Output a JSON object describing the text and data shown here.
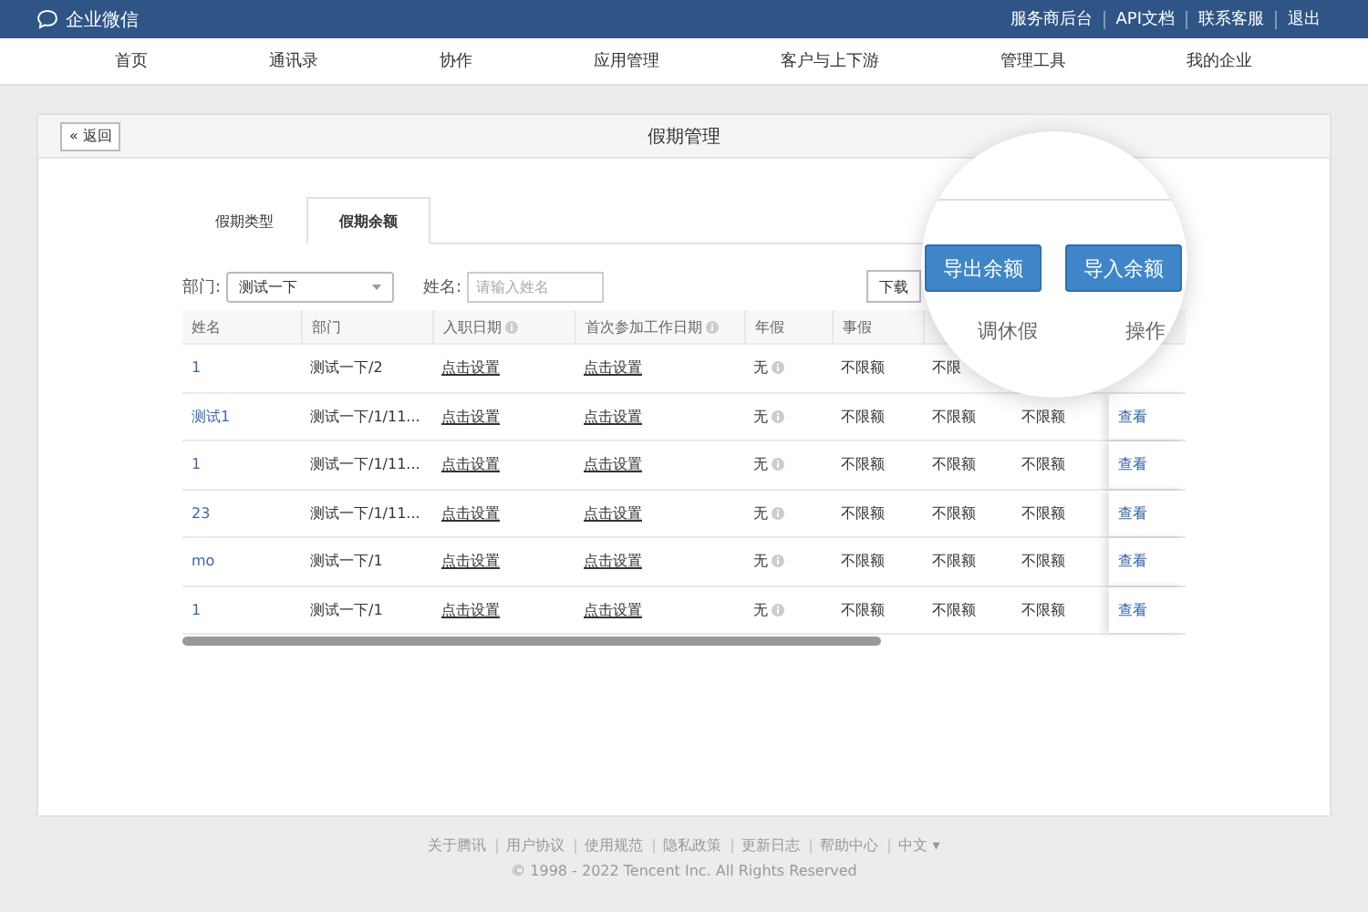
{
  "topbar": {
    "logo": "企业微信",
    "links": [
      "服务商后台",
      "API文档",
      "联系客服",
      "退出"
    ]
  },
  "nav": [
    "首页",
    "通讯录",
    "协作",
    "应用管理",
    "客户与上下游",
    "管理工具",
    "我的企业"
  ],
  "card": {
    "back": "« 返回",
    "title": "假期管理"
  },
  "tabs": [
    {
      "label": "假期类型",
      "selected": false
    },
    {
      "label": "假期余额",
      "selected": true
    }
  ],
  "filters": {
    "department_label": "部门:",
    "department": "测试一下",
    "name_label": "姓名:",
    "name_placeholder": "请输入姓名",
    "download": "下载"
  },
  "columns": [
    {
      "label": "姓名",
      "info": false
    },
    {
      "label": "部门",
      "info": false
    },
    {
      "label": "入职日期",
      "info": true
    },
    {
      "label": "首次参加工作日期",
      "info": true
    },
    {
      "label": "年假",
      "info": false
    },
    {
      "label": "事假",
      "info": false
    }
  ],
  "rows": [
    {
      "name": "1",
      "department": "测试一下/2",
      "hire_date": "点击设置",
      "work_date": "点击设置",
      "annual": "无",
      "leave": [
        "不限额",
        "不限"
      ]
    },
    {
      "name": "测试1",
      "department": "测试一下/1/11...",
      "hire_date": "点击设置",
      "work_date": "点击设置",
      "annual": "无",
      "leave": [
        "不限额",
        "不限额",
        "不限额"
      ],
      "action": "查看"
    },
    {
      "name": "1",
      "department": "测试一下/1/11...",
      "hire_date": "点击设置",
      "work_date": "点击设置",
      "annual": "无",
      "leave": [
        "不限额",
        "不限额",
        "不限额"
      ],
      "action": "查看"
    },
    {
      "name": "23",
      "department": "测试一下/1/11...",
      "hire_date": "点击设置",
      "work_date": "点击设置",
      "annual": "无",
      "leave": [
        "不限额",
        "不限额",
        "不限额"
      ],
      "action": "查看"
    },
    {
      "name": "mo",
      "department": "测试一下/1",
      "hire_date": "点击设置",
      "work_date": "点击设置",
      "annual": "无",
      "leave": [
        "不限额",
        "不限额",
        "不限额"
      ],
      "action": "查看"
    },
    {
      "name": "1",
      "department": "测试一下/1",
      "hire_date": "点击设置",
      "work_date": "点击设置",
      "annual": "无",
      "leave": [
        "不限额",
        "不限额",
        "不限额"
      ],
      "action": "查看"
    }
  ],
  "magnifier": {
    "buttons": [
      "导出余额",
      "导入余额"
    ],
    "columns": [
      "调休假",
      "操作"
    ]
  },
  "footer": {
    "links": [
      "关于腾讯",
      "用户协议",
      "使用规范",
      "隐私政策",
      "更新日志",
      "帮助中心",
      "中文 ▾"
    ],
    "copyright": "© 1998 - 2022 Tencent Inc. All Rights Reserved"
  }
}
